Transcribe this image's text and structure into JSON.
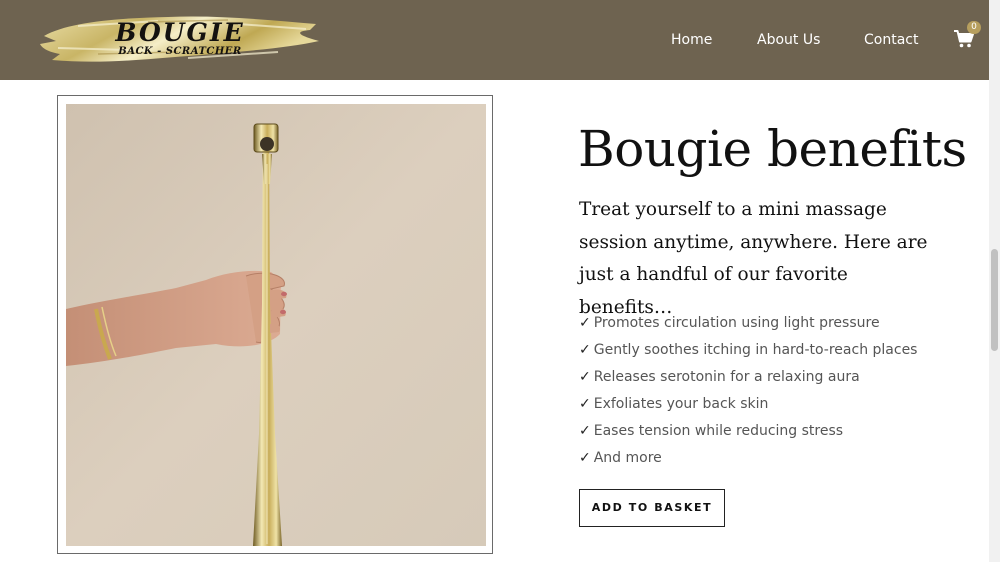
{
  "header": {
    "logo_main": "BOUGIE",
    "logo_sub": "BACK - SCRATCHER",
    "nav": [
      "Home",
      "About Us",
      "Contact"
    ],
    "cart_count": "0",
    "cart_icon": "shopping-cart-icon"
  },
  "main": {
    "title": "Bougie benefits",
    "intro": "Treat yourself to a mini massage session anytime, anywhere. Here are just a handful of our favorite benefits…",
    "check_mark": "✓",
    "benefits": [
      "Promotes circulation using light pressure",
      "Gently soothes itching in hard-to-reach places",
      "Releases serotonin for a relaxing aura",
      "Exfoliates your back skin",
      "Eases tension while reducing stress",
      "And more"
    ],
    "button_label": "ADD TO BASKET"
  },
  "colors": {
    "header_bg": "#6e6350",
    "gold": "#d9c77a",
    "photo_bg": "#d7cbbb"
  }
}
